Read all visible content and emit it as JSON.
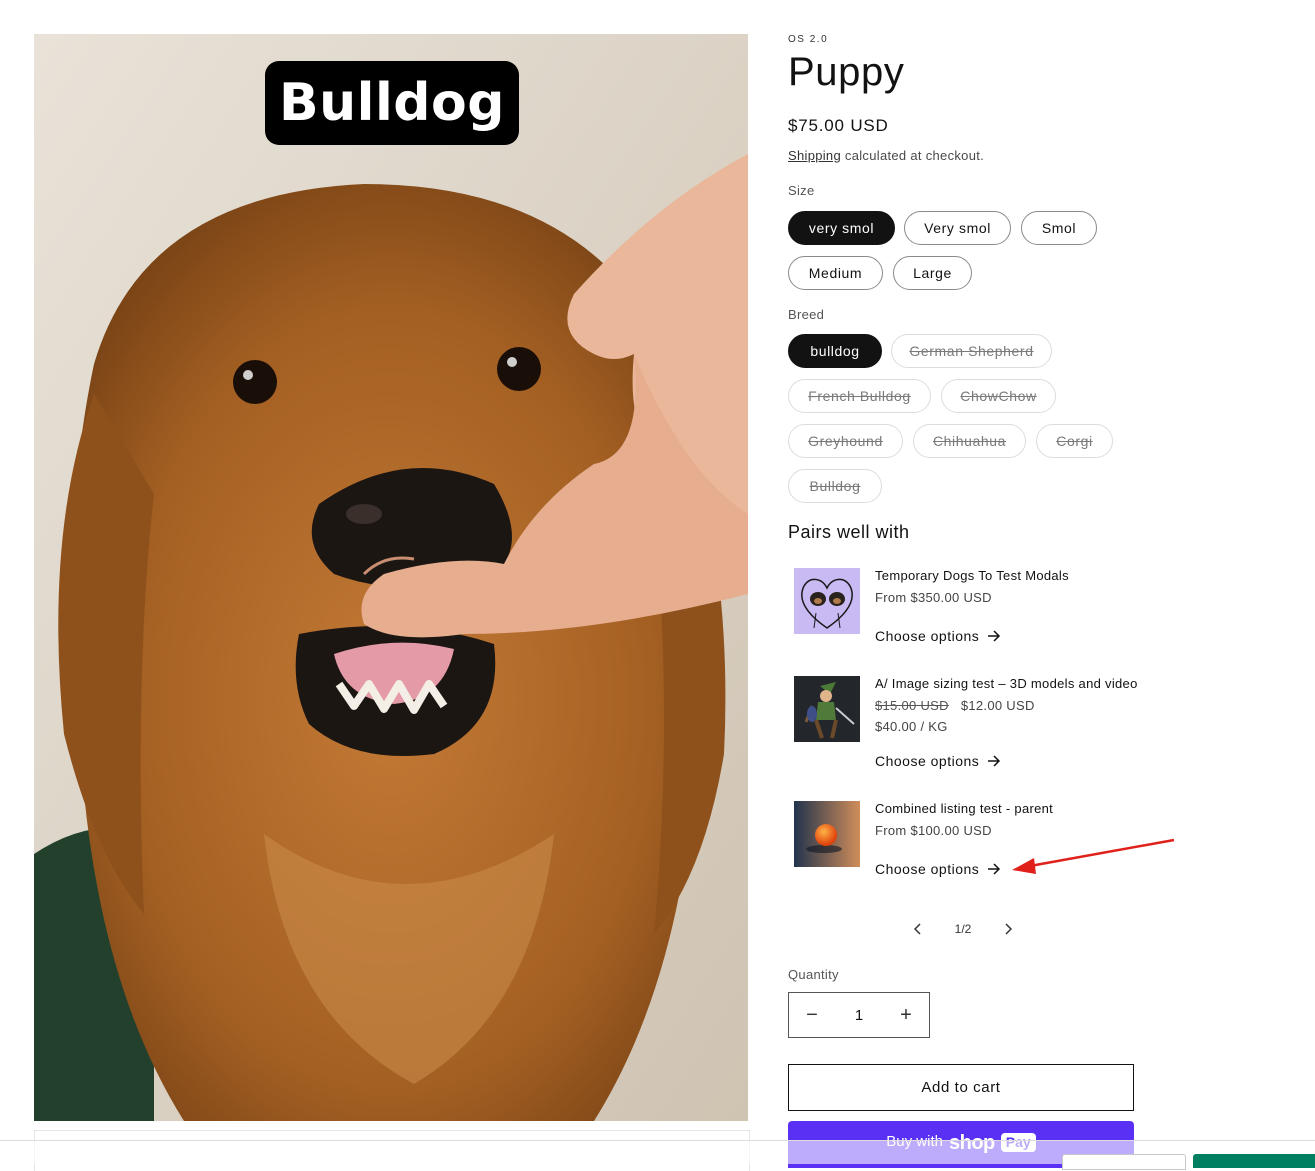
{
  "media": {
    "label": "Bulldog"
  },
  "product": {
    "vendor": "OS 2.0",
    "title": "Puppy",
    "price": "$75.00 USD",
    "shipping_link": "Shipping",
    "shipping_text": " calculated at checkout."
  },
  "options": {
    "size": {
      "label": "Size",
      "values": [
        "very smol",
        "Very smol",
        "Smol",
        "Medium",
        "Large"
      ],
      "selected": "very smol"
    },
    "breed": {
      "label": "Breed",
      "values": [
        "bulldog",
        "German Shepherd",
        "French Bulldog",
        "ChowChow",
        "Greyhound",
        "Chihuahua",
        "Corgi",
        "Bulldog"
      ],
      "selected": "bulldog",
      "unavailable": [
        "German Shepherd",
        "French Bulldog",
        "ChowChow",
        "Greyhound",
        "Chihuahua",
        "Corgi",
        "Bulldog"
      ]
    }
  },
  "pairs": {
    "heading": "Pairs well with",
    "items": [
      {
        "title": "Temporary Dogs To Test Modals",
        "price": "From $350.00 USD",
        "cta": "Choose options",
        "thumb_icon": "dogs-heart-image"
      },
      {
        "title": "A/ Image sizing test – 3D models and video",
        "price_old": "$15.00 USD",
        "price": "$12.00 USD",
        "unit_price": "$40.00 / KG",
        "cta": "Choose options",
        "thumb_icon": "elf-warrior-image"
      },
      {
        "title": "Combined listing test - parent",
        "price": "From $100.00 USD",
        "cta": "Choose options",
        "thumb_icon": "orange-ball-image"
      }
    ],
    "pager": {
      "current": "1",
      "separator": "/",
      "total": "2"
    }
  },
  "quantity": {
    "label": "Quantity",
    "value": "1",
    "decrease": "−",
    "increase": "+"
  },
  "buttons": {
    "add_to_cart": "Add to cart",
    "buy_with": "Buy with",
    "shop_brand": "shop",
    "pay_brand": "Pay"
  },
  "colors": {
    "accent_dark": "#121212",
    "shop_pay": "#5a31f4",
    "annotation_arrow": "#e0201b",
    "bottom_green": "#008060"
  }
}
